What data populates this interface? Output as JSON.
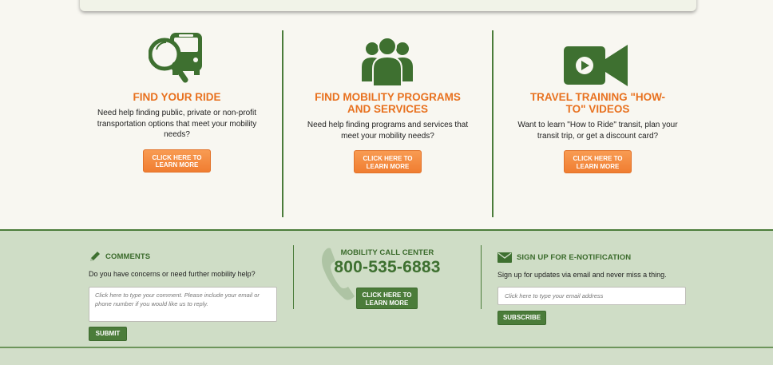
{
  "features": [
    {
      "title": "FIND YOUR RIDE",
      "description": "Need help finding public, private or non-profit transportation options that meet your mobility needs?",
      "button_label": "CLICK HERE TO LEARN MORE",
      "icon": "bus-search-icon"
    },
    {
      "title": "FIND MOBILITY PROGRAMS AND SERVICES",
      "description": "Need help finding programs and services that meet your mobility needs?",
      "button_label": "CLICK HERE TO LEARN MORE",
      "icon": "people-group-icon"
    },
    {
      "title": "TRAVEL TRAINING \"HOW-TO\" VIDEOS",
      "description": "Want to learn \"How to Ride\" transit, plan your transit trip, or get a discount card?",
      "button_label": "CLICK HERE TO LEARN MORE",
      "icon": "video-camera-icon"
    }
  ],
  "footer": {
    "comments": {
      "title": "COMMENTS",
      "prompt": "Do you have concerns or need further mobility help?",
      "placeholder": "Click here to type your comment. Please include your email or phone number if you would like us to reply.",
      "submit_label": "SUBMIT",
      "icon": "pencil-icon"
    },
    "call_center": {
      "title": "MOBILITY CALL CENTER",
      "phone": "800-535-6883",
      "button_label": "CLICK HERE TO LEARN MORE",
      "icon": "phone-handset-icon"
    },
    "enotification": {
      "title": "SIGN UP FOR E-NOTIFICATION",
      "prompt": "Sign up for updates via email and never miss a thing.",
      "placeholder": "Click here to type your email address",
      "subscribe_label": "SUBSCRIBE",
      "icon": "envelope-icon"
    }
  },
  "colors": {
    "accent_orange": "#e8711f",
    "brand_green": "#4b7c3a",
    "footer_bg": "#cfddc6"
  }
}
